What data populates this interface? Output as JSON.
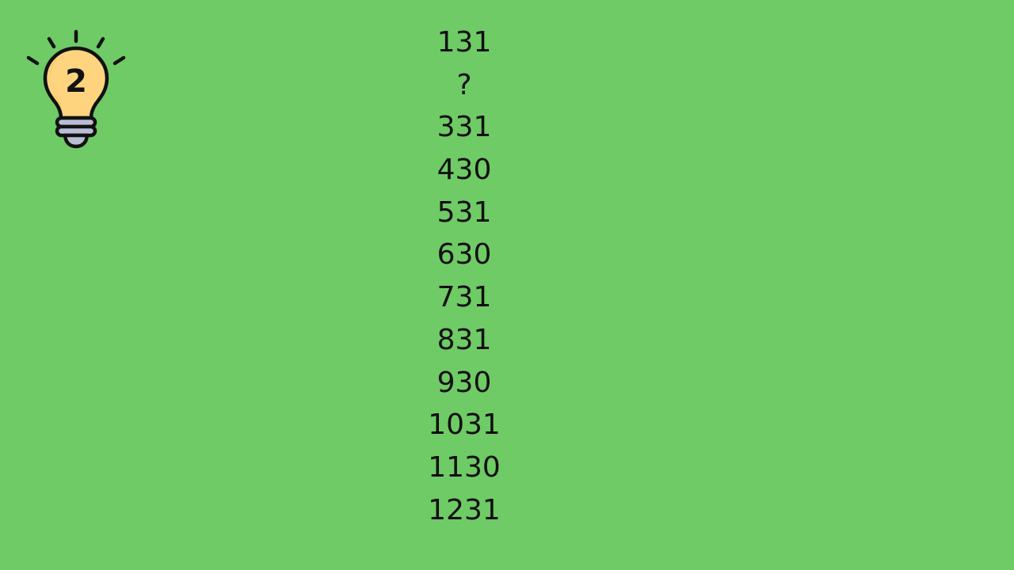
{
  "hint": {
    "icon": "lightbulb-icon",
    "number": "2",
    "bulb_color": "#ffd47e",
    "base_color": "#b9bdd6"
  },
  "sequence": [
    "131",
    "?",
    "331",
    "430",
    "531",
    "630",
    "731",
    "831",
    "930",
    "1031",
    "1130",
    "1231"
  ],
  "colors": {
    "background": "#6fcb65",
    "text": "#0f0f0f"
  }
}
